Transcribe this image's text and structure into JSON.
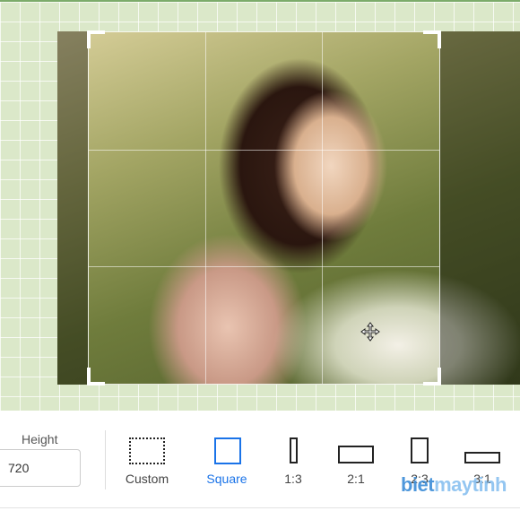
{
  "toolbar": {
    "height_label": "Height",
    "height_value": "720",
    "ratios": [
      {
        "id": "custom",
        "label": "Custom",
        "icon": "dashed-square-icon"
      },
      {
        "id": "square",
        "label": "Square",
        "icon": "square-icon",
        "active": true
      },
      {
        "id": "1-3",
        "label": "1:3",
        "icon": "tall-rect-icon"
      },
      {
        "id": "2-1",
        "label": "2:1",
        "icon": "wide-rect-icon"
      },
      {
        "id": "2-3",
        "label": "2:3",
        "icon": "portrait-rect-icon"
      },
      {
        "id": "3-1",
        "label": "3:1",
        "icon": "extra-wide-rect-icon"
      }
    ]
  },
  "watermark": {
    "part1": "biet",
    "part2": "maytinh"
  },
  "colors": {
    "accent": "#1a73e8",
    "canvas_bg": "#dbe8c9",
    "canvas_border": "#7cab6a"
  }
}
